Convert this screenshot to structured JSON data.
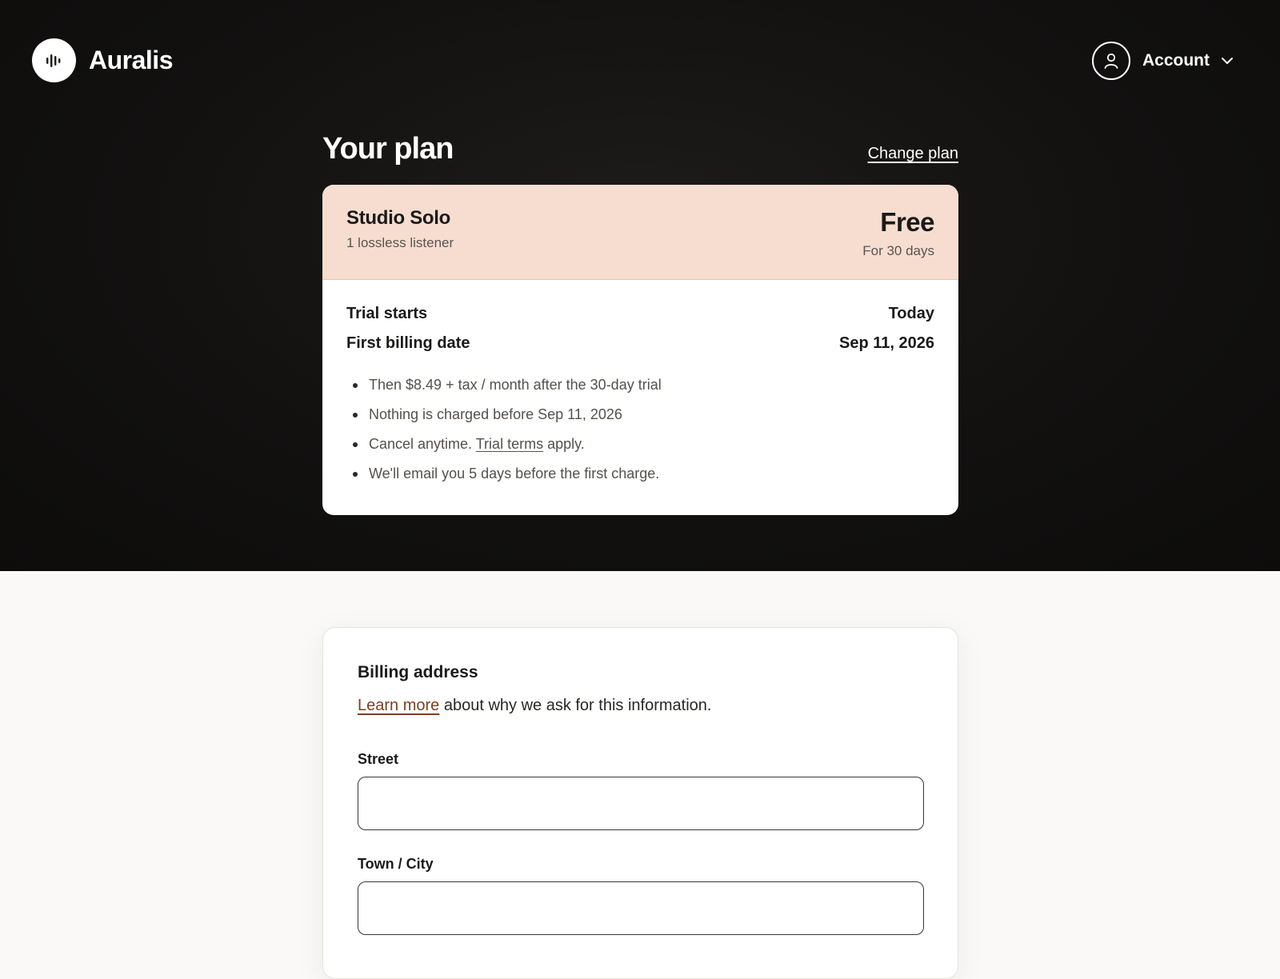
{
  "brand": {
    "name": "Auralis",
    "icon": "waveform-icon"
  },
  "account": {
    "label": "Account",
    "icon": "user-icon",
    "chevron_icon": "chevron-down-icon"
  },
  "plan_section": {
    "title": "Your plan",
    "change_link": "Change plan"
  },
  "plan": {
    "name": "Studio Solo",
    "description": "1 lossless listener",
    "price": "Free",
    "period": "For 30 days",
    "rows": [
      {
        "label": "Trial starts",
        "value": "Today"
      },
      {
        "label": "First billing date",
        "value": "Sep 11, 2026"
      }
    ],
    "bullets": {
      "item1": "Then $8.49 + tax / month after the 30-day trial",
      "item2": "Nothing is charged before Sep 11, 2026",
      "item3_prefix": "Cancel anytime. ",
      "item3_link": "Trial terms",
      "item3_suffix": " apply.",
      "item4": "We'll email you 5 days before the first charge."
    }
  },
  "billing": {
    "title": "Billing address",
    "learn_more": "Learn more",
    "note_suffix": " about why we ask for this information.",
    "fields": [
      {
        "label": "Street",
        "value": ""
      },
      {
        "label": "Town / City",
        "value": ""
      }
    ]
  },
  "colors": {
    "hero_bg": "#121110",
    "plan_header_bg": "#f6ddd0",
    "link_accent": "#7a4221",
    "page_bg": "#faf9f7"
  }
}
